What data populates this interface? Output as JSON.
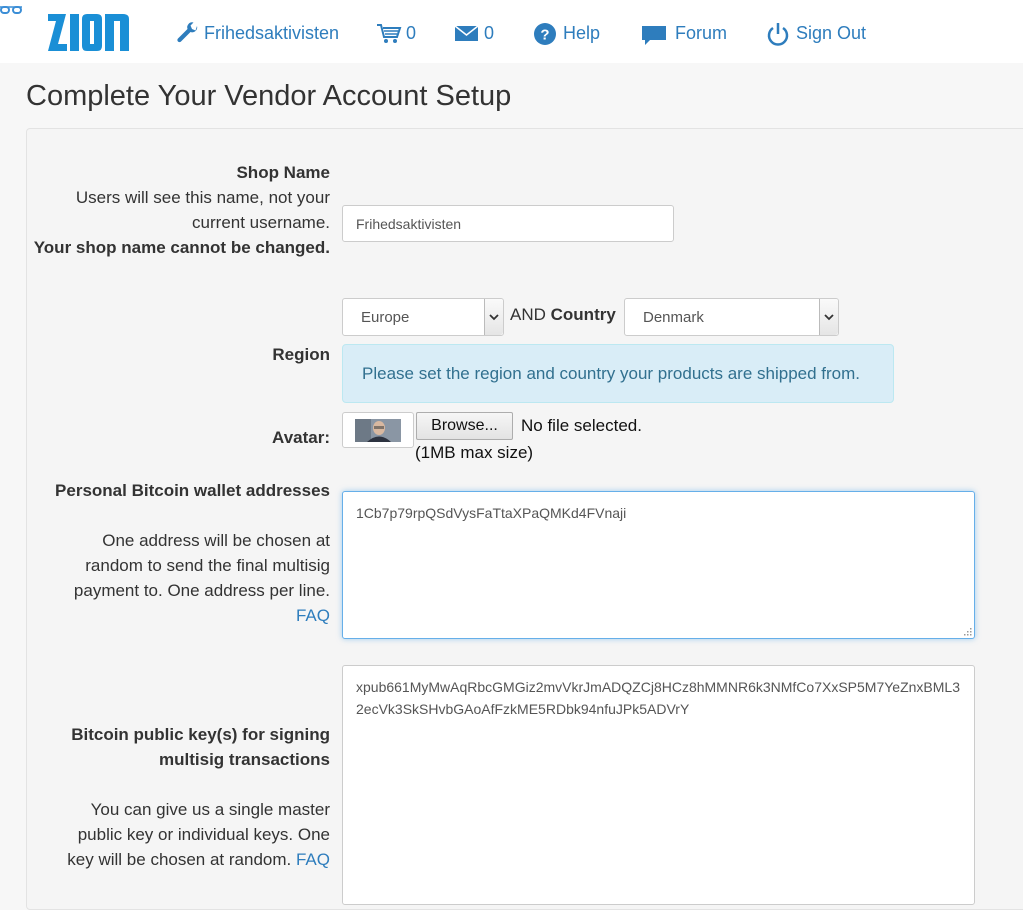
{
  "navbar": {
    "logo_text": "zion",
    "items": [
      {
        "label": "Frihedsaktivisten",
        "icon": "wrench-icon"
      },
      {
        "label": "0",
        "icon": "cart-icon"
      },
      {
        "label": "0",
        "icon": "envelope-icon"
      },
      {
        "label": "Help",
        "icon": "question-icon"
      },
      {
        "label": "Forum",
        "icon": "comment-icon"
      },
      {
        "label": "Sign Out",
        "icon": "power-icon"
      }
    ]
  },
  "page": {
    "title": "Complete Your Vendor Account Setup"
  },
  "form": {
    "shop_name": {
      "label": "Shop Name",
      "help": "Users will see this name, not your current username.",
      "warning": "Your shop name cannot be changed.",
      "value": "Frihedsaktivisten"
    },
    "region": {
      "label": "Region",
      "region_value": "Europe",
      "and_text": "AND",
      "country_label": "Country",
      "country_value": "Denmark",
      "info": "Please set the region and country your products are shipped from."
    },
    "avatar": {
      "label": "Avatar:",
      "browse_label": "Browse...",
      "file_status": "No file selected.",
      "max_size": "(1MB max size)"
    },
    "wallet": {
      "label": "Personal Bitcoin wallet addresses",
      "help": "One address will be chosen at random to send the final multisig payment to. One address per line.",
      "faq": "FAQ",
      "value": "1Cb7p79rpQSdVysFaTtaXPaQMKd4FVnaji"
    },
    "pubkeys": {
      "label": "Bitcoin public key(s) for signing multisig transactions",
      "help": "You can give us a single master public key or individual keys. One key will be chosen at random.",
      "faq": "FAQ",
      "value": "xpub661MyMwAqRbcGMGiz2mvVkrJmADQZCj8HCz8hMMNR6k3NMfCo7XxSP5M7YeZnxBML32ecVk3SkSHvbGAoAfFzkME5RDbk94nfuJPk5ADVrY"
    }
  },
  "colors": {
    "brand": "#2e7dbd",
    "info_bg": "#d9edf7",
    "info_text": "#31708f"
  }
}
